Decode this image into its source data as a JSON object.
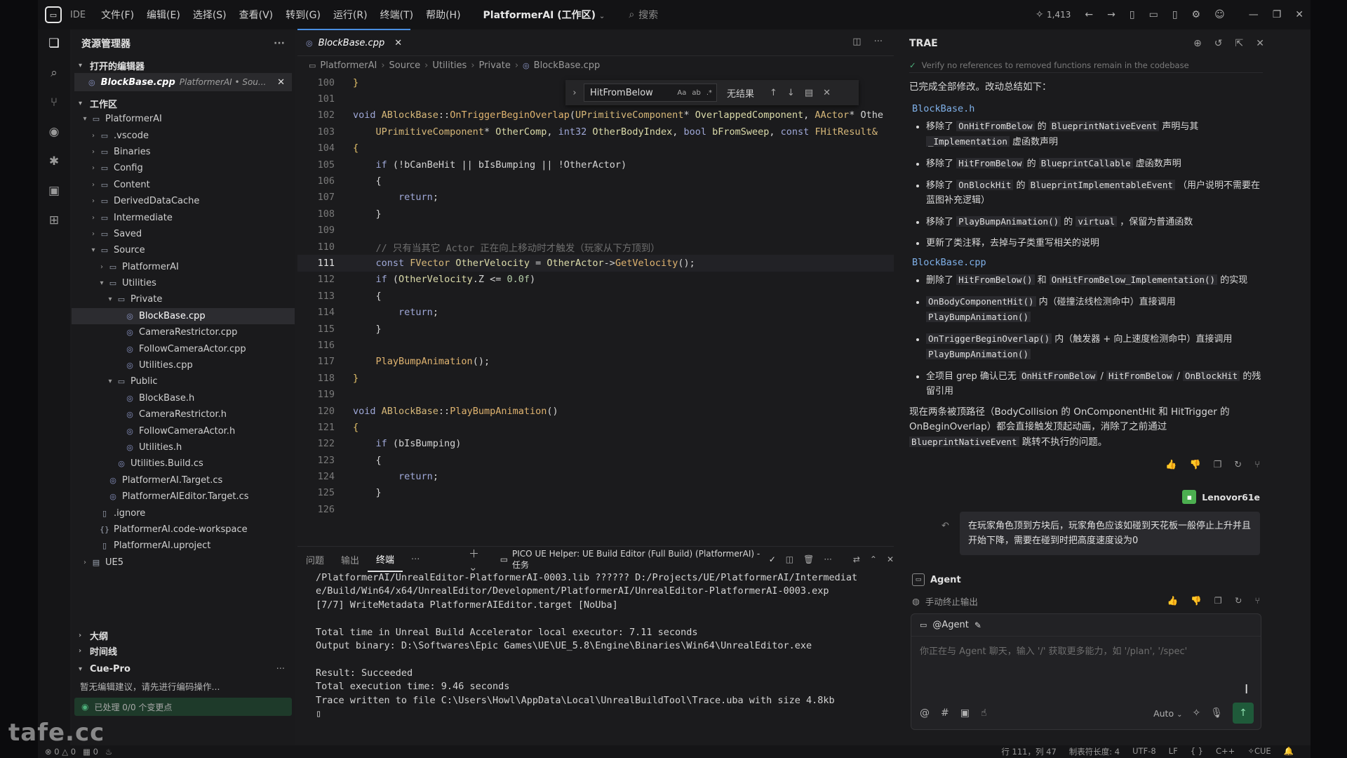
{
  "titlebar": {
    "ide": "IDE",
    "menu": [
      "文件(F)",
      "编辑(E)",
      "选择(S)",
      "查看(V)",
      "转到(G)",
      "运行(R)",
      "终端(T)",
      "帮助(H)"
    ],
    "workspace": "PlatformerAI (工作区)",
    "search": "搜索",
    "count": "1,413"
  },
  "sidebar": {
    "title": "资源管理器",
    "open_editors": "打开的编辑器",
    "open_file": "BlockBase.cpp",
    "open_file_path": "PlatformerAI • Sou...",
    "workspace": "工作区",
    "tree": [
      {
        "label": "PlatformerAI",
        "depth": 0,
        "type": "folder-open"
      },
      {
        "label": ".vscode",
        "depth": 1,
        "type": "folder"
      },
      {
        "label": "Binaries",
        "depth": 1,
        "type": "folder"
      },
      {
        "label": "Config",
        "depth": 1,
        "type": "folder"
      },
      {
        "label": "Content",
        "depth": 1,
        "type": "folder"
      },
      {
        "label": "DerivedDataCache",
        "depth": 1,
        "type": "folder"
      },
      {
        "label": "Intermediate",
        "depth": 1,
        "type": "folder"
      },
      {
        "label": "Saved",
        "depth": 1,
        "type": "folder"
      },
      {
        "label": "Source",
        "depth": 1,
        "type": "folder-open"
      },
      {
        "label": "PlatformerAI",
        "depth": 2,
        "type": "folder"
      },
      {
        "label": "Utilities",
        "depth": 2,
        "type": "folder-open"
      },
      {
        "label": "Private",
        "depth": 3,
        "type": "folder-open"
      },
      {
        "label": "BlockBase.cpp",
        "depth": 4,
        "type": "cpp",
        "selected": true
      },
      {
        "label": "CameraRestrictor.cpp",
        "depth": 4,
        "type": "cpp"
      },
      {
        "label": "FollowCameraActor.cpp",
        "depth": 4,
        "type": "cpp"
      },
      {
        "label": "Utilities.cpp",
        "depth": 4,
        "type": "cpp"
      },
      {
        "label": "Public",
        "depth": 3,
        "type": "folder-open"
      },
      {
        "label": "BlockBase.h",
        "depth": 4,
        "type": "h"
      },
      {
        "label": "CameraRestrictor.h",
        "depth": 4,
        "type": "h"
      },
      {
        "label": "FollowCameraActor.h",
        "depth": 4,
        "type": "h"
      },
      {
        "label": "Utilities.h",
        "depth": 4,
        "type": "h"
      },
      {
        "label": "Utilities.Build.cs",
        "depth": 3,
        "type": "cs"
      },
      {
        "label": "PlatformerAI.Target.cs",
        "depth": 2,
        "type": "cs"
      },
      {
        "label": "PlatformerAIEditor.Target.cs",
        "depth": 2,
        "type": "cs"
      },
      {
        "label": ".ignore",
        "depth": 1,
        "type": "file"
      },
      {
        "label": "PlatformerAI.code-workspace",
        "depth": 1,
        "type": "json"
      },
      {
        "label": "PlatformerAI.uproject",
        "depth": 1,
        "type": "file"
      },
      {
        "label": "UE5",
        "depth": 0,
        "type": "drive"
      }
    ],
    "outline": "大纲",
    "timeline": "时间线",
    "cue": "Cue-Pro",
    "cue_msg": "暂无编辑建议，请先进行编码操作...",
    "cue_status": "已处理 0/0 个变更点"
  },
  "editor": {
    "tab": "BlockBase.cpp",
    "breadcrumb": [
      "PlatformerAI",
      "Source",
      "Utilities",
      "Private",
      "BlockBase.cpp"
    ],
    "find": {
      "query": "HitFromBelow",
      "result": "无结果"
    },
    "lines": [
      {
        "n": "100",
        "indent": 0,
        "parts": [
          [
            "}",
            "br"
          ]
        ]
      },
      {
        "n": "101",
        "indent": 0,
        "parts": []
      },
      {
        "n": "102",
        "indent": 0,
        "parts": [
          [
            "void ",
            "kw"
          ],
          [
            "ABlockBase",
            "ty"
          ],
          [
            "::",
            ""
          ],
          [
            "OnTriggerBeginOverlap",
            "fn"
          ],
          [
            "(",
            ""
          ],
          [
            "UPrimitiveComponent",
            "ty"
          ],
          [
            "* ",
            ""
          ],
          [
            "OverlappedComponent",
            "vr"
          ],
          [
            ", ",
            ""
          ],
          [
            "AActor",
            "ty"
          ],
          [
            "* Othe",
            ""
          ]
        ]
      },
      {
        "n": "103",
        "indent": 1,
        "parts": [
          [
            "UPrimitiveComponent",
            "ty"
          ],
          [
            "* ",
            ""
          ],
          [
            "OtherComp",
            "vr"
          ],
          [
            ", ",
            ""
          ],
          [
            "int32 ",
            "kw"
          ],
          [
            "OtherBodyIndex",
            "vr"
          ],
          [
            ", ",
            ""
          ],
          [
            "bool ",
            "kw"
          ],
          [
            "bFromSweep",
            "vr"
          ],
          [
            ", ",
            ""
          ],
          [
            "const ",
            "kw"
          ],
          [
            "FHitResult&",
            "ty"
          ]
        ]
      },
      {
        "n": "104",
        "indent": 0,
        "parts": [
          [
            "{",
            "br"
          ]
        ]
      },
      {
        "n": "105",
        "indent": 1,
        "parts": [
          [
            "if ",
            "kw"
          ],
          [
            "(!bCanBeHit || bIsBumping || !OtherActor)",
            ""
          ]
        ]
      },
      {
        "n": "106",
        "indent": 1,
        "parts": [
          [
            "{",
            ""
          ]
        ]
      },
      {
        "n": "107",
        "indent": 2,
        "parts": [
          [
            "return",
            "kw"
          ],
          [
            ";",
            ""
          ]
        ]
      },
      {
        "n": "108",
        "indent": 1,
        "parts": [
          [
            "}",
            ""
          ]
        ]
      },
      {
        "n": "109",
        "indent": 0,
        "parts": []
      },
      {
        "n": "110",
        "indent": 1,
        "parts": [
          [
            "// 只有当其它 Actor 正在向上移动时才触发（玩家从下方顶到）",
            "cm"
          ]
        ]
      },
      {
        "n": "111",
        "indent": 1,
        "cur": true,
        "parts": [
          [
            "const ",
            "kw"
          ],
          [
            "FVector ",
            "ty"
          ],
          [
            "OtherVelocity",
            "vr"
          ],
          [
            " = ",
            ""
          ],
          [
            "OtherActor",
            "vr"
          ],
          [
            "->",
            ""
          ],
          [
            "GetVelocity",
            "fn"
          ],
          [
            "();",
            ""
          ]
        ]
      },
      {
        "n": "112",
        "indent": 1,
        "parts": [
          [
            "if ",
            "kw"
          ],
          [
            "(",
            ""
          ],
          [
            "OtherVelocity",
            "vr"
          ],
          [
            ".Z <= ",
            ""
          ],
          [
            "0.0f",
            "nm"
          ],
          [
            ")",
            ""
          ]
        ]
      },
      {
        "n": "113",
        "indent": 1,
        "parts": [
          [
            "{",
            ""
          ]
        ]
      },
      {
        "n": "114",
        "indent": 2,
        "parts": [
          [
            "return",
            "kw"
          ],
          [
            ";",
            ""
          ]
        ]
      },
      {
        "n": "115",
        "indent": 1,
        "parts": [
          [
            "}",
            ""
          ]
        ]
      },
      {
        "n": "116",
        "indent": 0,
        "parts": []
      },
      {
        "n": "117",
        "indent": 1,
        "parts": [
          [
            "PlayBumpAnimation",
            "fn"
          ],
          [
            "();",
            ""
          ]
        ]
      },
      {
        "n": "118",
        "indent": 0,
        "parts": [
          [
            "}",
            "br"
          ]
        ]
      },
      {
        "n": "119",
        "indent": 0,
        "parts": []
      },
      {
        "n": "120",
        "indent": 0,
        "parts": [
          [
            "void ",
            "kw"
          ],
          [
            "ABlockBase",
            "ty"
          ],
          [
            "::",
            ""
          ],
          [
            "PlayBumpAnimation",
            "fn"
          ],
          [
            "()",
            ""
          ]
        ]
      },
      {
        "n": "121",
        "indent": 0,
        "parts": [
          [
            "{",
            "br"
          ]
        ]
      },
      {
        "n": "122",
        "indent": 1,
        "parts": [
          [
            "if ",
            "kw"
          ],
          [
            "(bIsBumping)",
            ""
          ]
        ]
      },
      {
        "n": "123",
        "indent": 1,
        "parts": [
          [
            "{",
            ""
          ]
        ]
      },
      {
        "n": "124",
        "indent": 2,
        "parts": [
          [
            "return",
            "kw"
          ],
          [
            ";",
            ""
          ]
        ]
      },
      {
        "n": "125",
        "indent": 1,
        "parts": [
          [
            "}",
            ""
          ]
        ]
      },
      {
        "n": "126",
        "indent": 0,
        "parts": []
      }
    ]
  },
  "panel": {
    "tabs": [
      "问题",
      "输出",
      "终端"
    ],
    "more": "···",
    "task": "PICO UE Helper: UE Build Editor (Full Build) (PlatformerAI) - 任务",
    "output": [
      "/PlatformerAI/UnrealEditor-PlatformerAI-0003.lib ?????? D:/Projects/UE/PlatformerAI/Intermediat",
      "e/Build/Win64/x64/UnrealEditor/Development/PlatformerAI/UnrealEditor-PlatformerAI-0003.exp",
      "[7/7] WriteMetadata PlatformerAIEditor.target [NoUba]",
      "",
      "Total time in Unreal Build Accelerator local executor: 7.11 seconds",
      "Output binary: D:\\Softwares\\Epic Games\\UE\\UE_5.8\\Engine\\Binaries\\Win64\\UnrealEditor.exe",
      "",
      "Result: Succeeded",
      "Total execution time: 9.46 seconds",
      "Trace written to file C:\\Users\\Howl\\AppData\\Local\\UnrealBuildTool\\Trace.uba with size 4.8kb",
      "▯"
    ]
  },
  "chat": {
    "title": "TRAE",
    "verify": "Verify no references to removed functions remain in the codebase",
    "intro": "已完成全部修改。改动总结如下：",
    "section_h": "BlockBase.h",
    "h_items": [
      [
        [
          "移除了 ",
          ""
        ],
        [
          "OnHitFromBelow",
          "c"
        ],
        [
          " 的 ",
          ""
        ],
        [
          "BlueprintNativeEvent",
          "c"
        ],
        [
          " 声明与其 ",
          ""
        ],
        [
          "_Implementation",
          "c"
        ],
        [
          " 虚函数声明",
          ""
        ]
      ],
      [
        [
          "移除了 ",
          ""
        ],
        [
          "HitFromBelow",
          "c"
        ],
        [
          " 的 ",
          ""
        ],
        [
          "BlueprintCallable",
          "c"
        ],
        [
          " 虚函数声明",
          ""
        ]
      ],
      [
        [
          "移除了 ",
          ""
        ],
        [
          "OnBlockHit",
          "c"
        ],
        [
          " 的 ",
          ""
        ],
        [
          "BlueprintImplementableEvent",
          "c"
        ],
        [
          " （用户说明不需要在蓝图补充逻辑）",
          ""
        ]
      ],
      [
        [
          "移除了 ",
          ""
        ],
        [
          "PlayBumpAnimation()",
          "c"
        ],
        [
          " 的 ",
          ""
        ],
        [
          "virtual",
          "c"
        ],
        [
          " ，保留为普通函数",
          ""
        ]
      ],
      [
        [
          "更新了类注释，去掉与子类重写相关的说明",
          ""
        ]
      ]
    ],
    "section_cpp": "BlockBase.cpp",
    "cpp_items": [
      [
        [
          "删除了 ",
          ""
        ],
        [
          "HitFromBelow()",
          "c"
        ],
        [
          " 和 ",
          ""
        ],
        [
          "OnHitFromBelow_Implementation()",
          "c"
        ],
        [
          " 的实现",
          ""
        ]
      ],
      [
        [
          "OnBodyComponentHit()",
          "c"
        ],
        [
          " 内（碰撞法线检测命中）直接调用 ",
          ""
        ],
        [
          "PlayBumpAnimation()",
          "c"
        ]
      ],
      [
        [
          "OnTriggerBeginOverlap()",
          "c"
        ],
        [
          " 内（触发器 + 向上速度检测命中）直接调用 ",
          ""
        ],
        [
          "PlayBumpAnimation()",
          "c"
        ]
      ],
      [
        [
          "全项目 grep 确认已无 ",
          ""
        ],
        [
          "OnHitFromBelow",
          "c"
        ],
        [
          " / ",
          ""
        ],
        [
          "HitFromBelow",
          "c"
        ],
        [
          " / ",
          ""
        ],
        [
          "OnBlockHit",
          "c"
        ],
        [
          " 的残留引用",
          ""
        ]
      ]
    ],
    "summary": [
      [
        "现在两条被顶路径（BodyCollision 的 OnComponentHit 和 HitTrigger 的 OnBeginOverlap）都会直接触发顶起动画，消除了之前通过 ",
        ""
      ],
      [
        "BlueprintNativeEvent",
        "c"
      ],
      [
        " 跳转不执行的问题。",
        ""
      ]
    ],
    "user": "Lenovor61e",
    "user_msg": "在玩家角色顶到方块后，玩家角色应该如碰到天花板一般停止上升并且开始下降，需要在碰到时把高度速度设为0",
    "agent": "Agent",
    "stopped": "手动终止输出",
    "input_agent": "@Agent",
    "placeholder": "你正在与 Agent 聊天，输入 '/' 获取更多能力，如 '/plan', '/spec'",
    "mode": "Auto"
  },
  "status": {
    "errors": "0",
    "warnings": "0",
    "cursor": "行 111，列 47",
    "tab_size": "制表符长度: 4",
    "encoding": "UTF-8",
    "eol": "LF",
    "lang": "C++",
    "cue": "CUE"
  },
  "watermark": "tafe.cc"
}
